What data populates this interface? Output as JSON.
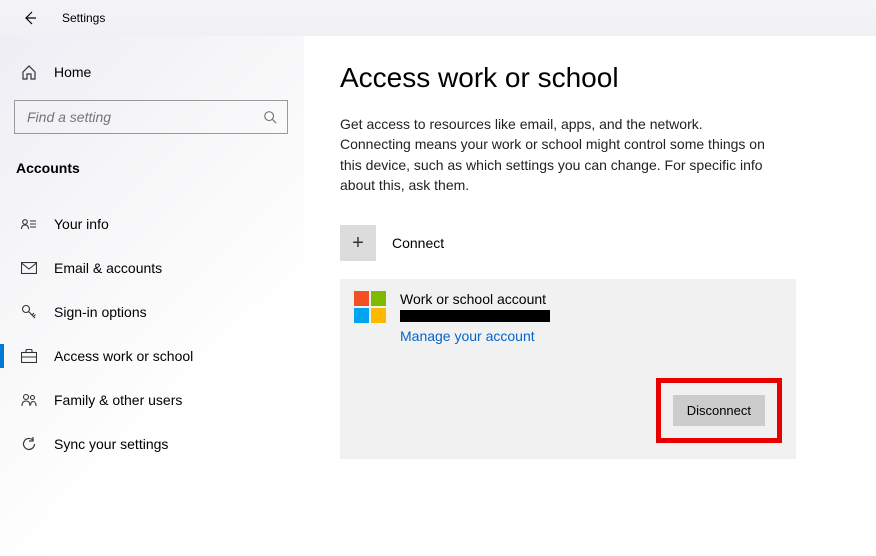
{
  "header": {
    "title": "Settings"
  },
  "sidebar": {
    "home_label": "Home",
    "search_placeholder": "Find a setting",
    "category_title": "Accounts",
    "nav": [
      {
        "label": "Your info"
      },
      {
        "label": "Email & accounts"
      },
      {
        "label": "Sign-in options"
      },
      {
        "label": "Access work or school"
      },
      {
        "label": "Family & other users"
      },
      {
        "label": "Sync your settings"
      }
    ],
    "selected_index": 3
  },
  "main": {
    "title": "Access work or school",
    "description": "Get access to resources like email, apps, and the network. Connecting means your work or school might control some things on this device, such as which settings you can change. For specific info about this, ask them.",
    "connect_label": "Connect",
    "account": {
      "title": "Work or school account",
      "email": "████████████████",
      "manage_link": "Manage your account",
      "disconnect_label": "Disconnect"
    }
  }
}
